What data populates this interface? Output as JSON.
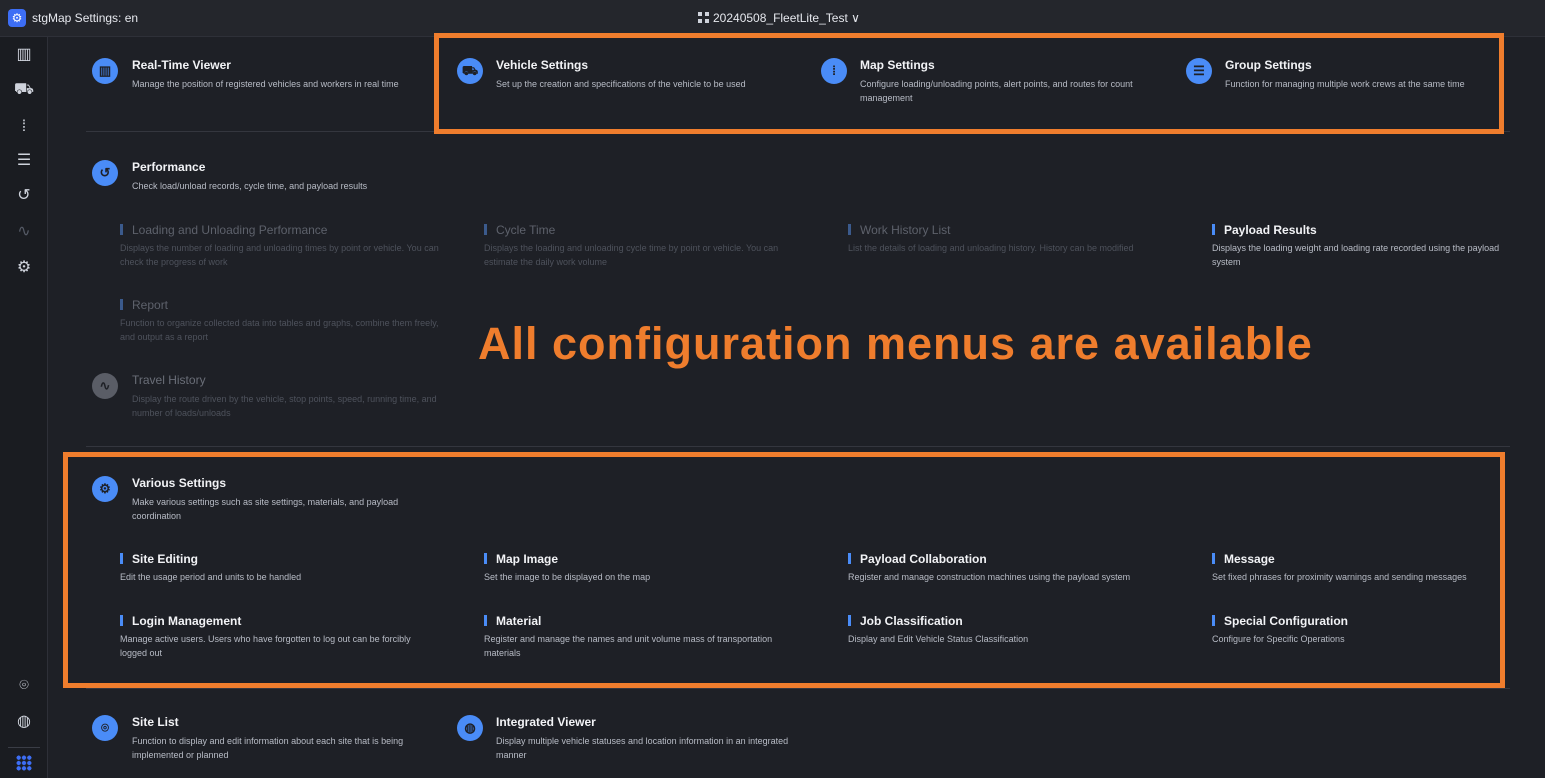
{
  "header": {
    "app_title": "stgMap Settings: en",
    "project": "20240508_FleetLite_Test",
    "chevron": "∨"
  },
  "sidebar_icons": [
    "map-icon",
    "truck-icon",
    "route-points-icon",
    "group-list-icon",
    "history-icon",
    "travel-icon",
    "gear-icon",
    "location-pin-icon",
    "globe-icon",
    "apps-grid-icon"
  ],
  "sections": {
    "realtime": {
      "title": "Real-Time Viewer",
      "desc": "Manage the position of registered vehicles and workers in real time"
    },
    "vehicle": {
      "title": "Vehicle Settings",
      "desc": "Set up the creation and specifications of the vehicle to be used"
    },
    "map": {
      "title": "Map Settings",
      "desc": "Configure loading/unloading points, alert points, and routes for count management"
    },
    "group": {
      "title": "Group Settings",
      "desc": "Function for managing multiple work crews at the same time"
    },
    "performance": {
      "title": "Performance",
      "desc": "Check load/unload records, cycle time, and payload results",
      "items": [
        {
          "title": "Loading and Unloading Performance",
          "desc": "Displays the number of loading and unloading times by point or vehicle. You can check the progress of work"
        },
        {
          "title": "Cycle Time",
          "desc": "Displays the loading and unloading cycle time by point or vehicle. You can estimate the daily work volume"
        },
        {
          "title": "Work History List",
          "desc": "List the details of loading and unloading history. History can be modified"
        },
        {
          "title": "Payload Results",
          "desc": "Displays the loading weight and loading rate recorded using the payload system"
        },
        {
          "title": "Report",
          "desc": "Function to organize collected data into tables and graphs, combine them freely, and output as a report"
        }
      ]
    },
    "travel": {
      "title": "Travel History",
      "desc": "Display the route driven by the vehicle, stop points, speed, running time, and number of loads/unloads"
    },
    "various": {
      "title": "Various Settings",
      "desc": "Make various settings such as site settings, materials, and payload coordination",
      "items": [
        {
          "title": "Site Editing",
          "desc": "Edit the usage period and units to be handled"
        },
        {
          "title": "Map Image",
          "desc": "Set the image to be displayed on the map"
        },
        {
          "title": "Payload Collaboration",
          "desc": "Register and manage construction machines using the payload system"
        },
        {
          "title": "Message",
          "desc": "Set fixed phrases for proximity warnings and sending messages"
        },
        {
          "title": "Login Management",
          "desc": "Manage active users. Users who have forgotten to log out can be forcibly logged out"
        },
        {
          "title": "Material",
          "desc": "Register and manage the names and unit volume mass of transportation materials"
        },
        {
          "title": "Job Classification",
          "desc": "Display and Edit Vehicle Status Classification"
        },
        {
          "title": "Special Configuration",
          "desc": "Configure for Specific Operations"
        }
      ]
    },
    "sitelist": {
      "title": "Site List",
      "desc": "Function to display and edit information about each site that is being implemented or planned"
    },
    "integrated": {
      "title": "Integrated Viewer",
      "desc": "Display multiple vehicle statuses and location information in an integrated manner"
    }
  },
  "annotation": "All configuration menus are available",
  "colors": {
    "accent": "#4a8cf7",
    "highlight": "#ef7d2d",
    "background": "#1e2026"
  }
}
